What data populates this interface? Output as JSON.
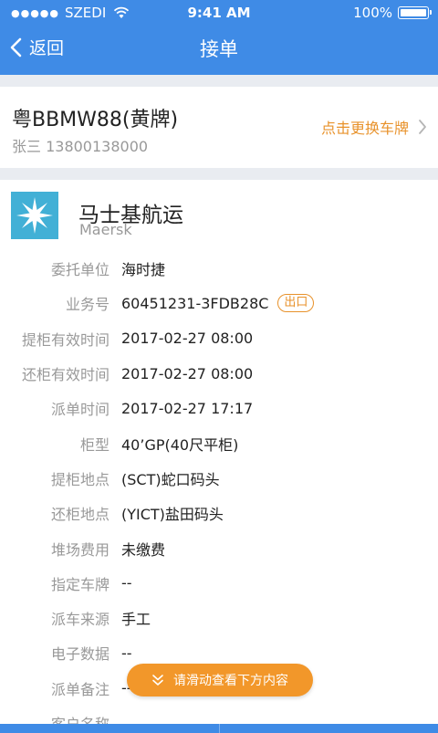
{
  "status": {
    "carrier": "SZEDI",
    "time": "9:41 AM",
    "battery": "100%"
  },
  "nav": {
    "back_label": "返回",
    "title": "接单"
  },
  "vehicle": {
    "plate": "粤BBMW88(黄牌)",
    "driver": "张三 13800138000",
    "change_label": "点击更换车牌"
  },
  "company": {
    "name": "马士基航运",
    "name_en": "Maersk"
  },
  "details": [
    {
      "label": "委托单位",
      "value": "海时捷"
    },
    {
      "label": "业务号",
      "value": "60451231-3FDB28C",
      "tag": "出口"
    },
    {
      "label": "提柜有效时间",
      "value": "2017-02-27 08:00"
    },
    {
      "label": "还柜有效时间",
      "value": "2017-02-27 08:00"
    },
    {
      "label": "派单时间",
      "value": "2017-02-27 17:17"
    },
    {
      "label": "柜型",
      "value": "40’GP(40尺平柜)"
    },
    {
      "label": "提柜地点",
      "value": "(SCT)蛇口码头"
    },
    {
      "label": "还柜地点",
      "value": "(YICT)盐田码头"
    },
    {
      "label": "堆场费用",
      "value": "未缴费"
    },
    {
      "label": "指定车牌",
      "value": "--"
    },
    {
      "label": "派车来源",
      "value": "手工"
    },
    {
      "label": "电子数据",
      "value": "--"
    },
    {
      "label": "派单备注",
      "value": "--"
    },
    {
      "label": "客户名称",
      "value": ""
    }
  ],
  "scroll_hint": {
    "label": "请滑动查看下方内容"
  },
  "colors": {
    "primary": "#3f8be6",
    "accent": "#e8922b",
    "hint": "#f2972a",
    "logo": "#42b0d6"
  }
}
